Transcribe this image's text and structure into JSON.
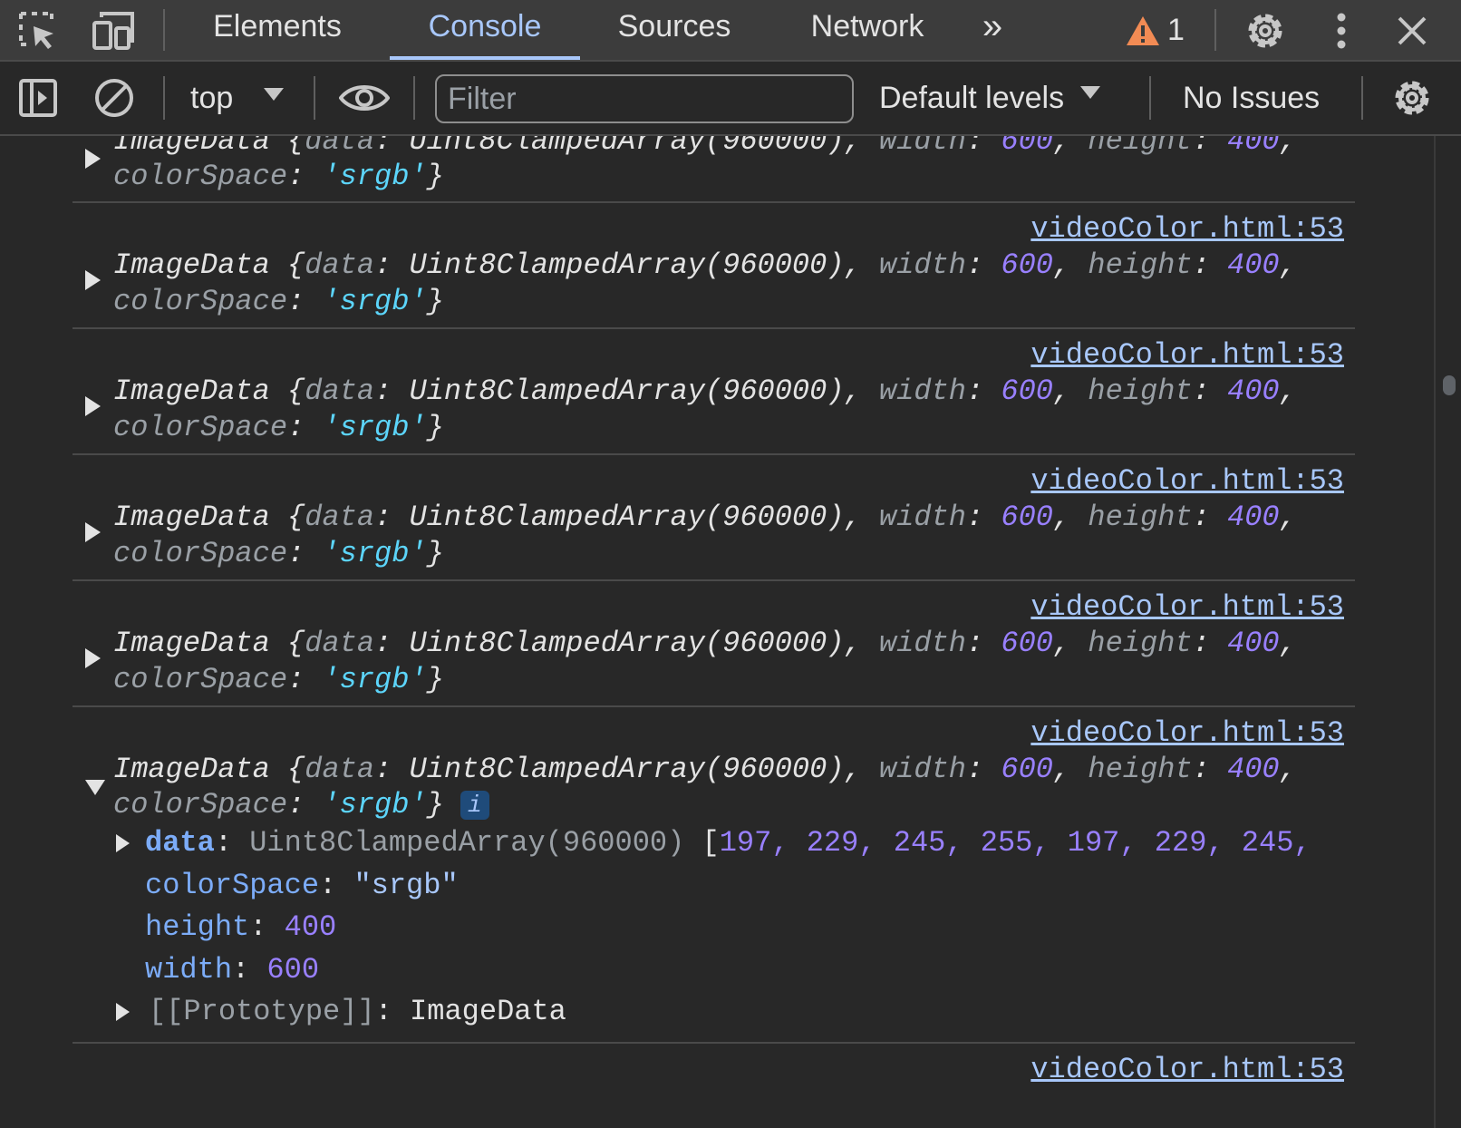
{
  "tabs": {
    "elements": "Elements",
    "console": "Console",
    "sources": "Sources",
    "network": "Network",
    "more": "»",
    "warning_count": "1"
  },
  "toolbar": {
    "context": "top",
    "filter_placeholder": "Filter",
    "levels": "Default levels",
    "issues": "No Issues"
  },
  "message": {
    "source": "videoColor.html:53",
    "prefix": "ImageData {",
    "data_key": "data",
    "data_value": "Uint8ClampedArray(960000)",
    "width_key": "width",
    "width_value": "600",
    "height_key": "height",
    "height_value": "400",
    "colorspace_key": "colorSpace",
    "colorspace_value": "'srgb'",
    "info_badge": "i"
  },
  "expanded": {
    "data_key": "data",
    "data_type": "Uint8ClampedArray(960000)",
    "data_values": "197, 229, 245, 255, 197, 229, 245,",
    "colorspace_key": "colorSpace",
    "colorspace_value": "\"srgb\"",
    "height_key": "height",
    "height_value": "400",
    "width_key": "width",
    "width_value": "600",
    "prototype_key": "[[Prototype]]",
    "prototype_value": "ImageData"
  },
  "colors": {
    "background": "#282828",
    "toolbar": "#3c3c3c",
    "accent": "#a8c7fa",
    "number": "#9980ff",
    "string": "#5cd5fb",
    "warning": "#f28b54"
  }
}
